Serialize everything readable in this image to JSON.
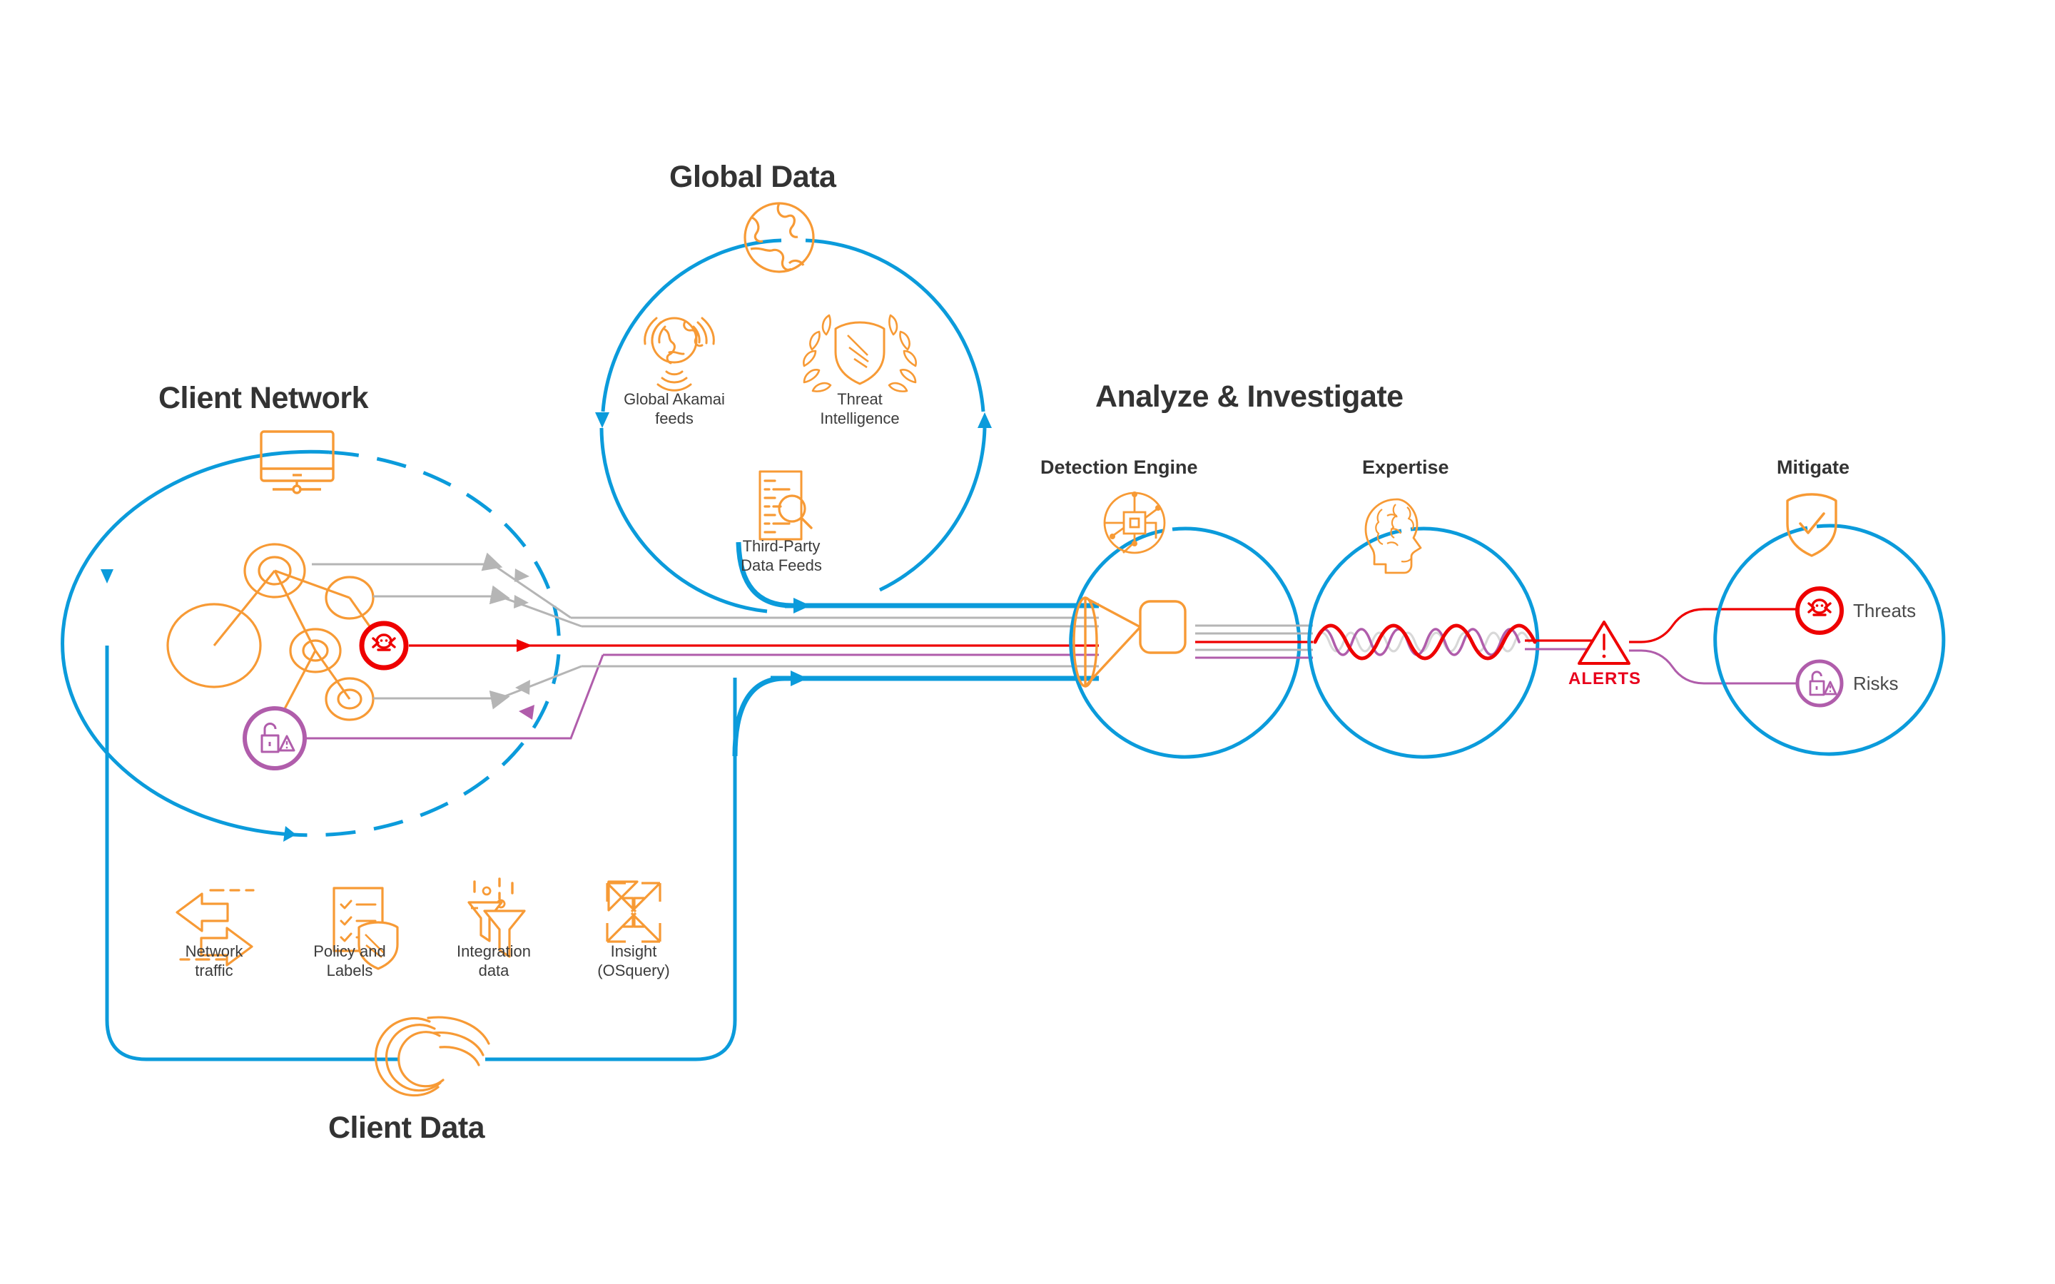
{
  "colors": {
    "blue": "#0b9bdb",
    "orange": "#f79a35",
    "red": "#ee0000",
    "alert_red": "#e8001c",
    "purple": "#b05dab",
    "gray_line": "#bdbdbd",
    "text_dark": "#333333",
    "text_body": "#3c3c3c",
    "white": "#ffffff"
  },
  "headings": {
    "client_network": "Client Network",
    "global_data": "Global Data",
    "analyze_investigate": "Analyze & Investigate",
    "client_data": "Client Data"
  },
  "stages": {
    "detection_engine": "Detection Engine",
    "expertise": "Expertise",
    "mitigate": "Mitigate"
  },
  "global_data": {
    "top_icon": "globe-icon",
    "items": [
      {
        "icon": "global-feeds-icon",
        "label": "Global Akamai\nfeeds"
      },
      {
        "icon": "laurel-shield-icon",
        "label": "Threat\nIntelligence"
      },
      {
        "icon": "document-search-icon",
        "label": "Third-Party\nData Feeds"
      }
    ]
  },
  "client_data": {
    "logo": "akamai-wave-logo",
    "items": [
      {
        "icon": "bidirectional-arrows-icon",
        "label": "Network\ntraffic"
      },
      {
        "icon": "checklist-shield-icon",
        "label": "Policy and\nLabels"
      },
      {
        "icon": "funnel-binary-icon",
        "label": "Integration\ndata"
      },
      {
        "icon": "pinwheel-arrows-icon",
        "label": "Insight\n(OSquery)"
      }
    ]
  },
  "client_network": {
    "top_icon": "monitor-icon",
    "threat_node_icon": "skull-crossbones-icon",
    "risk_node_icon": "unlocked-padlock-warning-icon"
  },
  "detection_engine": {
    "top_icon": "circuit-chip-icon",
    "body_icon": "funnel-cone-icon"
  },
  "expertise": {
    "top_icon": "brain-head-icon",
    "body_icon": "waveforms-icon"
  },
  "alerts": {
    "icon": "warning-triangle-icon",
    "label": "ALERTS"
  },
  "mitigate": {
    "top_icon": "shield-check-icon",
    "items": [
      {
        "icon": "skull-crossbones-icon",
        "label": "Threats",
        "color": "#ee0000"
      },
      {
        "icon": "unlocked-padlock-warning-icon",
        "label": "Risks",
        "color": "#b05dab"
      }
    ]
  }
}
